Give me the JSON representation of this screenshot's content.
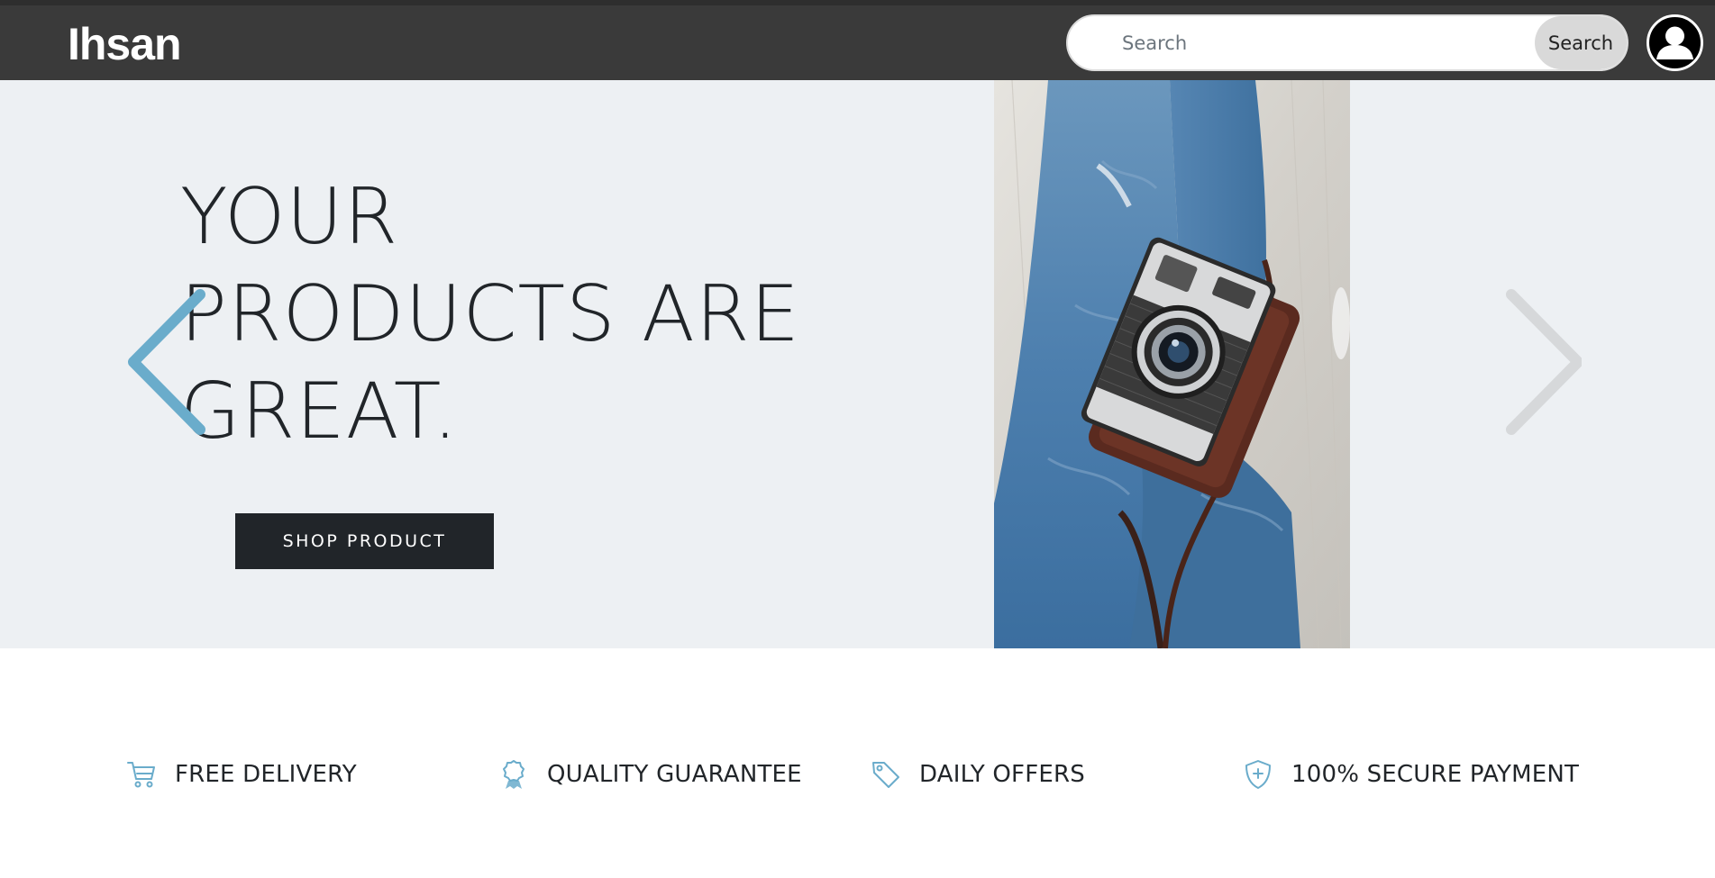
{
  "header": {
    "brand": "Ihsan",
    "search": {
      "placeholder": "Search",
      "value": "",
      "button_label": "Search"
    },
    "avatar_icon": "user-icon"
  },
  "hero": {
    "title_lines": [
      "YOUR",
      "PRODUCTS ARE",
      "GREAT."
    ],
    "cta_label": "SHOP PRODUCT",
    "prev_icon": "chevron-left-icon",
    "next_icon": "chevron-right-icon",
    "image_alt": "camera-on-jeans-photo"
  },
  "features": [
    {
      "label": "FREE DELIVERY",
      "icon": "cart-icon"
    },
    {
      "label": "QUALITY GUARANTEE",
      "icon": "award-icon"
    },
    {
      "label": "DAILY OFFERS",
      "icon": "tag-icon"
    },
    {
      "label": "100% SECURE PAYMENT",
      "icon": "shield-icon"
    }
  ],
  "colors": {
    "header_bg": "#3a3a3a",
    "hero_bg": "#edf0f3",
    "accent": "#6aaccb",
    "button_dark": "#212529",
    "arrow_inactive": "#d6d8da"
  }
}
